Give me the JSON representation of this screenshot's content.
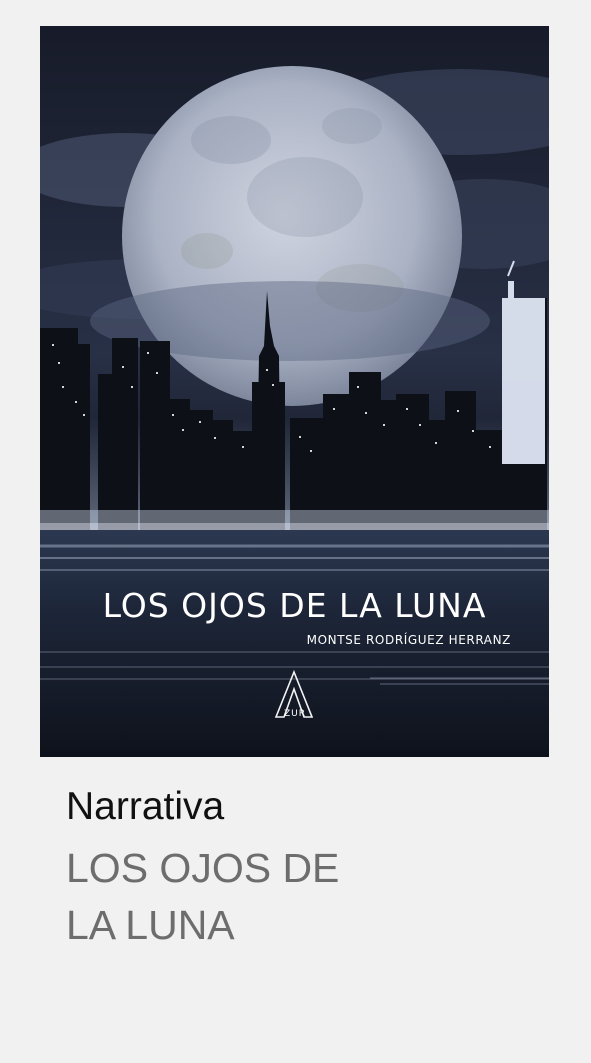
{
  "cover": {
    "title": "LOS OJOS DE LA LUNA",
    "author": "MONTSE RODRÍGUEZ HERRANZ",
    "publisher": "ZUR"
  },
  "details": {
    "category": "Narrativa",
    "title_line_1": "LOS OJOS DE",
    "title_line_2": "LA LUNA"
  },
  "colors": {
    "page_background": "#f1f1f1",
    "category_text": "#111111",
    "title_text": "#6d6d6d",
    "cover_sky": "#1b2030",
    "cover_water": "#1c2538"
  }
}
